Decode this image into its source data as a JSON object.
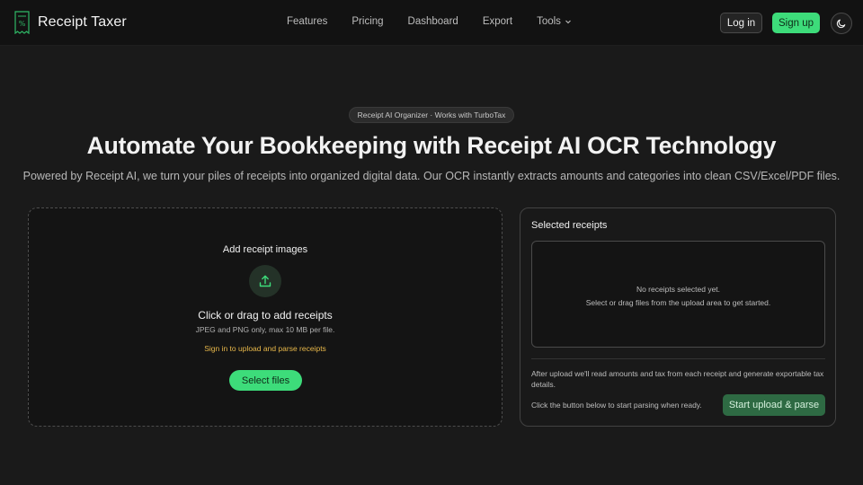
{
  "app": {
    "name": "Receipt Taxer",
    "logo_icon": "receipt-tax-logo-icon"
  },
  "nav": {
    "items": [
      {
        "label": "Features"
      },
      {
        "label": "Pricing"
      },
      {
        "label": "Dashboard"
      },
      {
        "label": "Export"
      },
      {
        "label": "Tools",
        "icon": "chevron-down-icon"
      }
    ]
  },
  "auth": {
    "login_label": "Log in",
    "signup_label": "Sign up",
    "theme_icon": "moon-icon"
  },
  "hero": {
    "badge": "Receipt AI Organizer · Works with TurboTax",
    "title": "Automate Your Bookkeeping with Receipt AI OCR Technology",
    "subtitle": "Powered by Receipt AI, we turn your piles of receipts into organized digital data. Our OCR instantly extracts amounts and categories into clean CSV/Excel/PDF files."
  },
  "upload": {
    "title": "Add receipt images",
    "icon": "upload-icon",
    "cta": "Click or drag to add receipts",
    "hint": "JPEG and PNG only, max 10 MB per file.",
    "warning": "Sign in to upload and parse receipts",
    "select_label": "Select files"
  },
  "selected": {
    "title": "Selected receipts",
    "empty_line1": "No receipts selected yet.",
    "empty_line2": "Select or drag files from the upload area to get started.",
    "note": "After upload we'll read amounts and tax from each receipt and generate exportable tax details.",
    "footer": "Click the button below to start parsing when ready.",
    "parse_label": "Start upload & parse"
  },
  "colors": {
    "accent": "#3ddc7a",
    "warning": "#e8b84a",
    "background": "#1a1a1a"
  }
}
